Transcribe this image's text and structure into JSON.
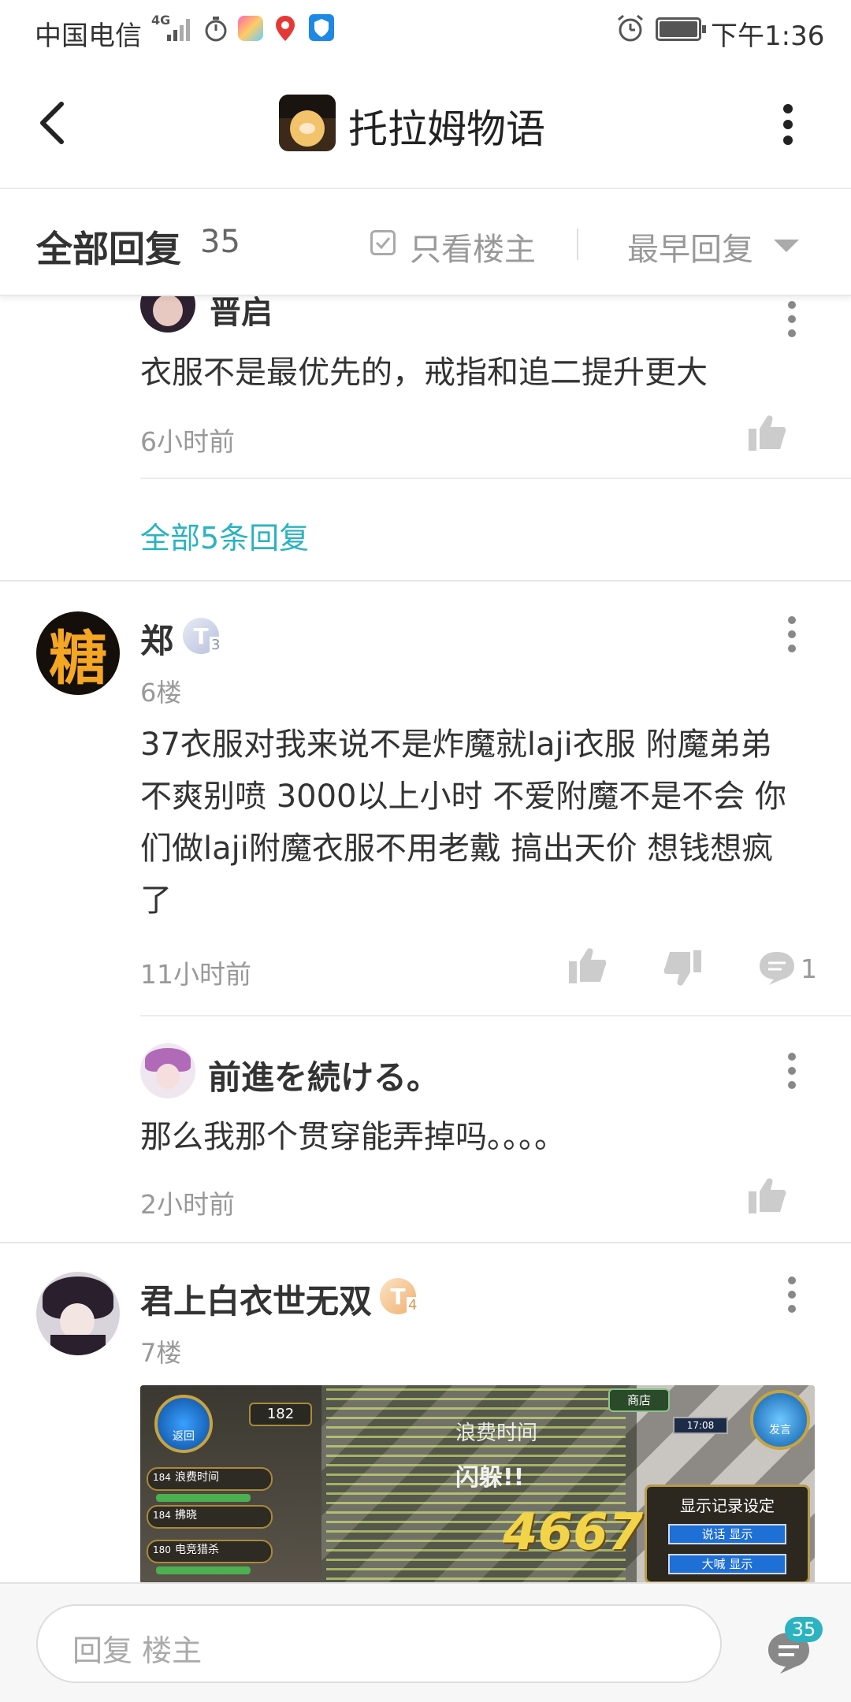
{
  "status_bar": {
    "carrier": "中国电信",
    "network": "4G",
    "time": "下午1:36"
  },
  "header": {
    "back_icon": "chevron-left-icon",
    "forum_name": "托拉姆物语",
    "more_icon": "vertical-dots-icon"
  },
  "filter_bar": {
    "title": "全部回复",
    "count": "35",
    "only_op_label": "只看楼主",
    "sort_label": "最早回复"
  },
  "partial_reply": {
    "name": "晋启",
    "text": "衣服不是最优先的，戒指和追二提升更大",
    "time": "6小时前"
  },
  "all_replies_link": "全部5条回复",
  "post_6": {
    "avatar_char": "糖",
    "name": "郑",
    "level_badge": "T",
    "level_num": "3",
    "floor": "6楼",
    "lines": [
      "37衣服对我来说不是炸魔就laji衣服 附魔弟弟",
      "不爽别喷  3000以上小时 不爱附魔不是不会 你",
      "们做laji附魔衣服不用老戴 搞出天价 想钱想疯",
      "了"
    ],
    "time": "11小时前",
    "comment_count": "1"
  },
  "reply_1": {
    "name": "前進を続ける。",
    "text": "那么我那个贯穿能弄掉吗。。。。",
    "time": "2小时前"
  },
  "post_7": {
    "name": "君上白衣世无双",
    "level_badge": "T",
    "level_num": "4",
    "floor": "7楼",
    "screenshot": {
      "back_label": "返回",
      "level": "182",
      "skill_1": "浪费时间",
      "skill_2": "拂晓",
      "skill_3": "电竞猎杀",
      "shop_label": "商店",
      "talk_label": "发言",
      "damage": "4667",
      "dodge_text": "闪躲!!",
      "waste_text": "浪费时间",
      "panel_title": "显示记录设定",
      "panel_btn_1": "说话 显示",
      "panel_btn_2": "大喊 显示",
      "clock": "17:08",
      "level_num_1": "184",
      "level_num_2": "184",
      "level_num_3": "180"
    }
  },
  "bottom_bar": {
    "placeholder": "回复  楼主",
    "comment_badge": "35"
  }
}
